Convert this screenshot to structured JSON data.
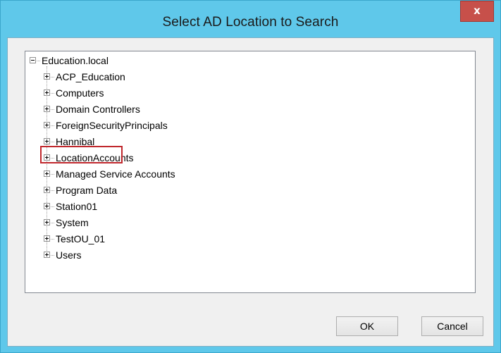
{
  "window": {
    "title": "Select AD Location to Search",
    "close_label": "x"
  },
  "tree": {
    "root": {
      "label": "Education.local",
      "expanded": true
    },
    "children": [
      {
        "label": "ACP_Education"
      },
      {
        "label": "Computers"
      },
      {
        "label": "Domain Controllers"
      },
      {
        "label": "ForeignSecurityPrincipals"
      },
      {
        "label": "Hannibal",
        "highlighted": true
      },
      {
        "label": "LocationAccounts"
      },
      {
        "label": "Managed Service Accounts"
      },
      {
        "label": "Program Data"
      },
      {
        "label": "Station01"
      },
      {
        "label": "System"
      },
      {
        "label": "TestOU_01"
      },
      {
        "label": "Users"
      }
    ]
  },
  "buttons": {
    "ok": "OK",
    "cancel": "Cancel"
  },
  "colors": {
    "titlebar": "#5fc8ea",
    "close_button": "#c7504a",
    "highlight_box": "#c0282d"
  }
}
